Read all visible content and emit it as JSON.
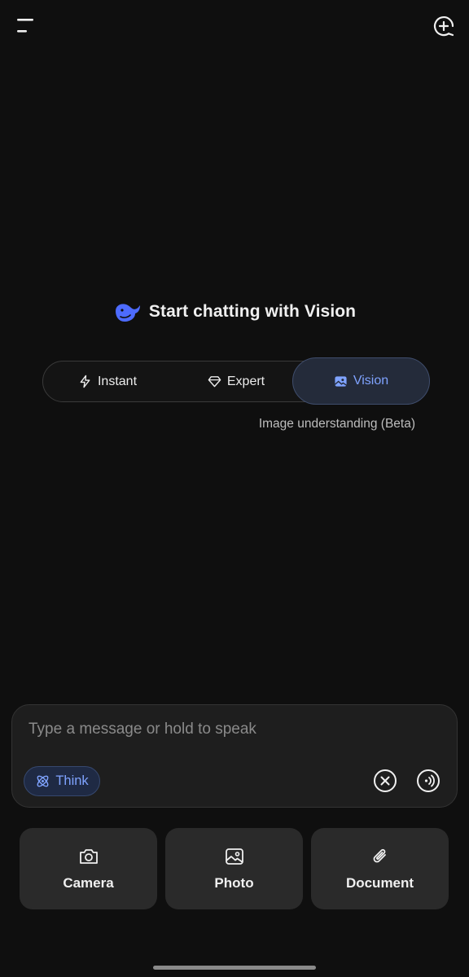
{
  "header": {
    "title": "Start chatting with Vision"
  },
  "modes": {
    "items": [
      {
        "label": "Instant",
        "icon": "bolt-icon"
      },
      {
        "label": "Expert",
        "icon": "diamond-icon"
      },
      {
        "label": "Vision",
        "icon": "image-icon",
        "selected": true
      }
    ],
    "note": "Image understanding (Beta)"
  },
  "composer": {
    "placeholder": "Type a message or hold to speak",
    "think_label": "Think"
  },
  "attachments": {
    "camera": "Camera",
    "photo": "Photo",
    "document": "Document"
  },
  "colors": {
    "accent": "#7fa3ff",
    "background": "#0f0f0f",
    "surface": "#1e1e1e",
    "brand": "#4d6bfe"
  }
}
